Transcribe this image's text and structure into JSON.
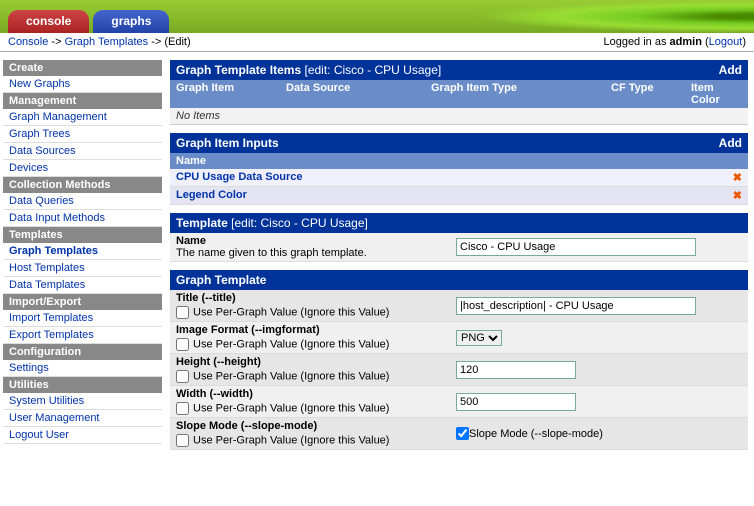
{
  "tabs": {
    "console": "console",
    "graphs": "graphs"
  },
  "breadcrumb": {
    "console": "Console",
    "sep": " -> ",
    "graph_templates": "Graph Templates",
    "edit": "(Edit)",
    "logged_in": "Logged in as ",
    "user": "admin",
    "logout": "Logout"
  },
  "sidebar": {
    "create": "Create",
    "new_graphs": "New Graphs",
    "management": "Management",
    "graph_management": "Graph Management",
    "graph_trees": "Graph Trees",
    "data_sources": "Data Sources",
    "devices": "Devices",
    "collection_methods": "Collection Methods",
    "data_queries": "Data Queries",
    "data_input_methods": "Data Input Methods",
    "templates": "Templates",
    "graph_templates": "Graph Templates",
    "host_templates": "Host Templates",
    "data_templates": "Data Templates",
    "import_export": "Import/Export",
    "import_templates": "Import Templates",
    "export_templates": "Export Templates",
    "configuration": "Configuration",
    "settings": "Settings",
    "utilities": "Utilities",
    "system_utilities": "System Utilities",
    "user_management": "User Management",
    "logout_user": "Logout User"
  },
  "gti": {
    "title": "Graph Template Items",
    "edit_label": " [edit: Cisco - CPU Usage]",
    "add": "Add",
    "cols": {
      "c1": "Graph Item",
      "c2": "Data Source",
      "c3": "Graph Item Type",
      "c4": "CF Type",
      "c5": "Item Color"
    },
    "no_items": "No Items"
  },
  "gii": {
    "title": "Graph Item Inputs",
    "add": "Add",
    "name": "Name",
    "rows": [
      {
        "label": "CPU Usage Data Source"
      },
      {
        "label": "Legend Color"
      }
    ]
  },
  "template": {
    "title": "Template",
    "edit_label": " [edit: Cisco - CPU Usage]",
    "name_label": "Name",
    "name_help": "The name given to this graph template.",
    "name_value": "Cisco - CPU Usage"
  },
  "gt": {
    "title": "Graph Template",
    "use_per_graph": "Use Per-Graph Value (Ignore this Value)",
    "rows": {
      "title_label": "Title (--title)",
      "title_value": "|host_description| - CPU Usage",
      "imgfmt_label": "Image Format (--imgformat)",
      "imgfmt_value": "PNG",
      "height_label": "Height (--height)",
      "height_value": "120",
      "width_label": "Width (--width)",
      "width_value": "500",
      "slope_label": "Slope Mode (--slope-mode)",
      "slope_cb_label": "Slope Mode (--slope-mode)"
    }
  }
}
